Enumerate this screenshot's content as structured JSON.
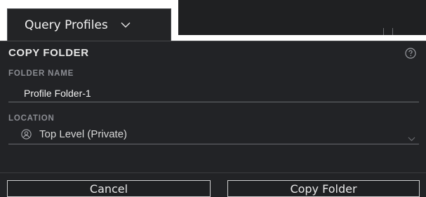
{
  "header": {
    "dropdown_label": "Query Profiles",
    "dropdown_icon": "chevron-down-icon"
  },
  "dialog": {
    "title": "COPY FOLDER",
    "help_icon": "help-circle-icon",
    "folder_name": {
      "label": "FOLDER NAME",
      "value": "Profile Folder-1"
    },
    "location": {
      "label": "LOCATION",
      "selected": "Top Level (Private)",
      "icon": "user-icon",
      "chevron_icon": "chevron-down-icon"
    },
    "buttons": {
      "cancel": "Cancel",
      "confirm": "Copy Folder"
    }
  },
  "colors": {
    "panel_bg": "#222326",
    "topbar_bg": "#1f2022",
    "text_primary": "#f0f0f0",
    "label_muted": "#8b8d93",
    "divider": "#6a6c70"
  }
}
